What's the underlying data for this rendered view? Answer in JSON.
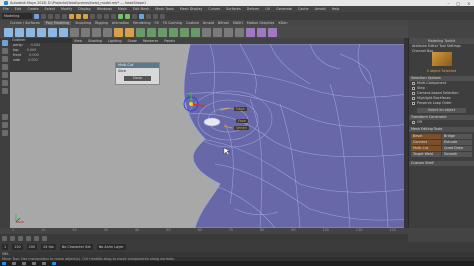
{
  "window": {
    "title": "Autodesk Maya 2018: D:\\Projects\\Head\\scenes\\head_model.mb*   ---   headShape1",
    "controls": [
      "–",
      "□",
      "×"
    ]
  },
  "menubar": [
    "File",
    "Edit",
    "Create",
    "Select",
    "Modify",
    "Display",
    "Windows",
    "Mesh",
    "Edit Mesh",
    "Mesh Tools",
    "Mesh Display",
    "Curves",
    "Surfaces",
    "Deform",
    "UV",
    "Generate",
    "Cache",
    "Arnold",
    "Help"
  ],
  "mode_selector": "Modeling",
  "shelf": {
    "tabs": [
      "Curves / Surfaces",
      "Poly Modeling",
      "Sculpting",
      "Rigging",
      "Animation",
      "Rendering",
      "FX",
      "FX Caching",
      "Custom",
      "Arnold",
      "Bifrost",
      "MASH",
      "Motion Graphics",
      "XGen"
    ],
    "active_tab": "Poly Modeling"
  },
  "outliner": {
    "header": "Outliner",
    "rows": [
      {
        "name": "persp",
        "value": "0.000"
      },
      {
        "name": "top",
        "value": "0.000"
      },
      {
        "name": "front",
        "value": "0.000"
      },
      {
        "name": "side",
        "value": "0.000"
      }
    ]
  },
  "viewport_menu": [
    "View",
    "Shading",
    "Lighting",
    "Show",
    "Renderer",
    "Panels"
  ],
  "floating_panel": {
    "header": "Multi-Cut",
    "row": "Slice",
    "button": "Done"
  },
  "manipulator_tags": [
    "Edge",
    "Face",
    "Vertex"
  ],
  "timeline": {
    "ticks": [
      "1",
      "10",
      "20",
      "30",
      "40",
      "50",
      "60",
      "70",
      "80",
      "90",
      "100",
      "110",
      "120"
    ]
  },
  "range": {
    "start": "1",
    "end": "120",
    "anim_end": "200",
    "fps": "24 fps",
    "char_set": "No Character Set",
    "anim_layer": "No Anim Layer"
  },
  "status_line": "MEL",
  "help_line": "Move Tool: Use manipulator to move object(s). Ctrl+middle-drag to move components along normals.",
  "modeling_toolkit": {
    "header": "Modeling Toolkit",
    "tabs": "Attribute Editor   Tool Settings   Channel Box",
    "selected_label": "0 object Selected",
    "sections": [
      {
        "title": "Selection Options",
        "checks": [
          "Multi-Component",
          "Step",
          "Camera-based Selection",
          "Highlight Backfaces",
          "Preserve Loop Order"
        ]
      },
      {
        "title": "Transform Constraint",
        "checks": [
          "Off"
        ]
      },
      {
        "title": "Mesh Editing Tools",
        "buttons": [
          "Bevel",
          "Bridge",
          "Connect",
          "Extrude",
          "Multi-Cut",
          "Quad Draw",
          "Target Weld",
          "Smooth"
        ]
      },
      {
        "title": "Custom Shelf",
        "checks": []
      }
    ],
    "select_button": "Select an object"
  },
  "colors": {
    "mesh_fill": "#6868a8",
    "wire": "#9aa6e0",
    "viewport_bg": "#a8a8a8",
    "accent": "#e0a04a",
    "highlight_blue": "#6fa3d8"
  }
}
